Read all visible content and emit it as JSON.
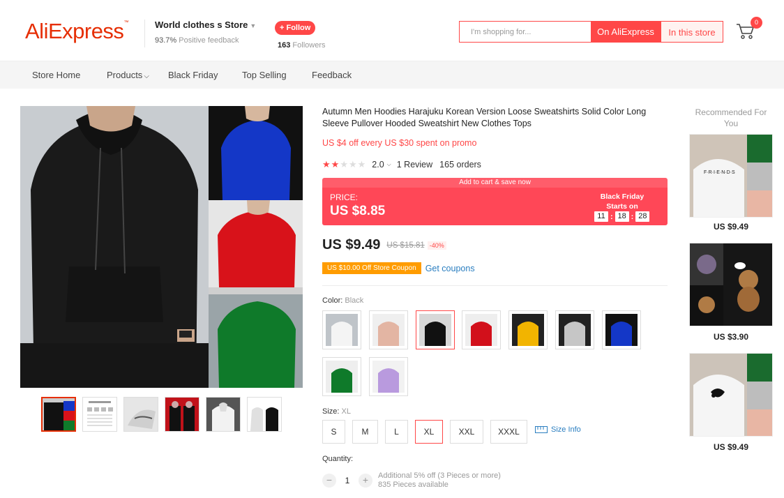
{
  "header": {
    "logo": "AliExpress",
    "store_name": "World clothes s Store",
    "feedback_pct": "93.7%",
    "feedback_label": "Positive feedback",
    "follow_label": "+ Follow",
    "followers_count": "163",
    "followers_label": "Followers",
    "search_placeholder": "I'm shopping for...",
    "search_ali_label": "On AliExpress",
    "search_store_label": "In this store",
    "cart_count": "0"
  },
  "nav": {
    "items": [
      "Store Home",
      "Products",
      "Black Friday",
      "Top Selling",
      "Feedback"
    ]
  },
  "product": {
    "title": "Autumn Men Hoodies Harajuku Korean Version Loose Sweatshirts Solid Color Long Sleeve Pullover Hooded Sweatshirt New Clothes Tops",
    "promo": "US $4 off every US $30 spent on promo",
    "rating_value": "2.0",
    "rating_stars": 2,
    "reviews": "1 Review",
    "orders": "165 orders",
    "banner_top": "Add to cart & save now",
    "banner_label": "PRICE:",
    "banner_price": "US $8.85",
    "bf_line1": "Black Friday",
    "bf_line2": "Starts on",
    "countdown": [
      "11",
      "18",
      "28"
    ],
    "price": "US $9.49",
    "old_price": "US $15.81",
    "discount": "-40%",
    "coupon": "US $10.00 Off Store Coupon",
    "get_coupons": "Get coupons",
    "color_label": "Color:",
    "color_value": "Black",
    "colors": [
      "white",
      "pink",
      "black",
      "red",
      "yellow",
      "gray",
      "blue",
      "green",
      "purple"
    ],
    "size_label": "Size:",
    "size_value": "XL",
    "sizes": [
      "S",
      "M",
      "L",
      "XL",
      "XXL",
      "XXXL"
    ],
    "size_info": "Size Info",
    "quantity_label": "Quantity:",
    "quantity": "1",
    "qty_note1": "Additional 5% off (3 Pieces or more)",
    "qty_note2": "835 Pieces available"
  },
  "recommended": {
    "title": "Recommended For You",
    "items": [
      {
        "price": "US $9.49"
      },
      {
        "price": "US $3.90"
      },
      {
        "price": "US $9.49"
      }
    ]
  },
  "colors": {
    "brand": "#e62e04",
    "accent": "#ff4747",
    "banner": "#ff4757",
    "coupon": "#ff9c00",
    "link": "#2a7ec0"
  }
}
